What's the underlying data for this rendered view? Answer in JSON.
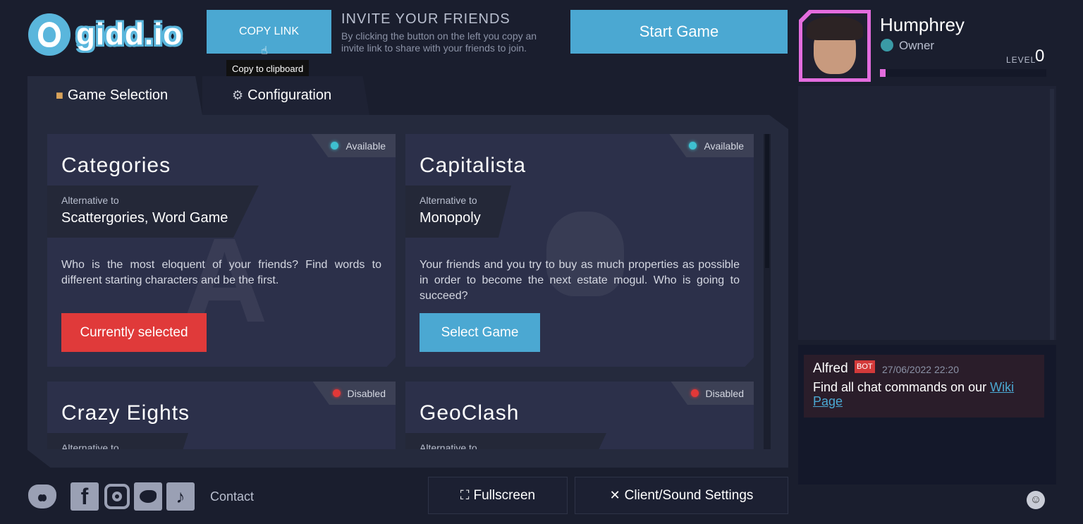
{
  "header": {
    "logo_text": "gidd.io",
    "copy_link_label": "COPY LINK",
    "tooltip": "Copy to clipboard",
    "invite_title": "INVITE YOUR FRIENDS",
    "invite_desc": "By clicking the button on the left you copy an invite link to share with your friends to join.",
    "start_label": "Start Game"
  },
  "profile": {
    "name": "Humphrey",
    "role": "Owner",
    "level_label": "LEVEL",
    "level": "0",
    "level_progress": 0.03,
    "accent": "#e36cde"
  },
  "tabs": [
    {
      "label": "Game Selection",
      "icon": "box-icon"
    },
    {
      "label": "Configuration",
      "icon": "gears-icon"
    }
  ],
  "games": [
    {
      "title": "Categories",
      "status": "Available",
      "alt_label": "Alternative to",
      "alt": "Scattergories, Word Game",
      "desc": "Who is the most eloquent of your friends? Find words to different starting characters and be the first.",
      "button": "Currently selected"
    },
    {
      "title": "Capitalista",
      "status": "Available",
      "alt_label": "Alternative to",
      "alt": "Monopoly",
      "desc": "Your friends and you try to buy as much properties as possible in order to become the next estate mogul. Who is going to succeed?",
      "button": "Select Game"
    },
    {
      "title": "Crazy Eights",
      "status": "Disabled",
      "alt_label": "Alternative to"
    },
    {
      "title": "GeoClash",
      "status": "Disabled",
      "alt_label": "Alternative to"
    }
  ],
  "footer": {
    "contact": "Contact",
    "fullscreen": "Fullscreen",
    "settings": "Client/Sound Settings",
    "socials": [
      "discord-icon",
      "facebook-icon",
      "instagram-icon",
      "twitter-icon",
      "tiktok-icon"
    ]
  },
  "chat": {
    "author": "Alfred",
    "badge": "BOT",
    "time": "27/06/2022 22:20",
    "text": "Find all chat commands on our ",
    "link": "Wiki Page"
  },
  "colors": {
    "background": "#1a1e2e",
    "primary_button": "#4ba8d2",
    "selected_button": "#e03a3a",
    "available": "#3ec0d0",
    "disabled": "#e33838"
  }
}
